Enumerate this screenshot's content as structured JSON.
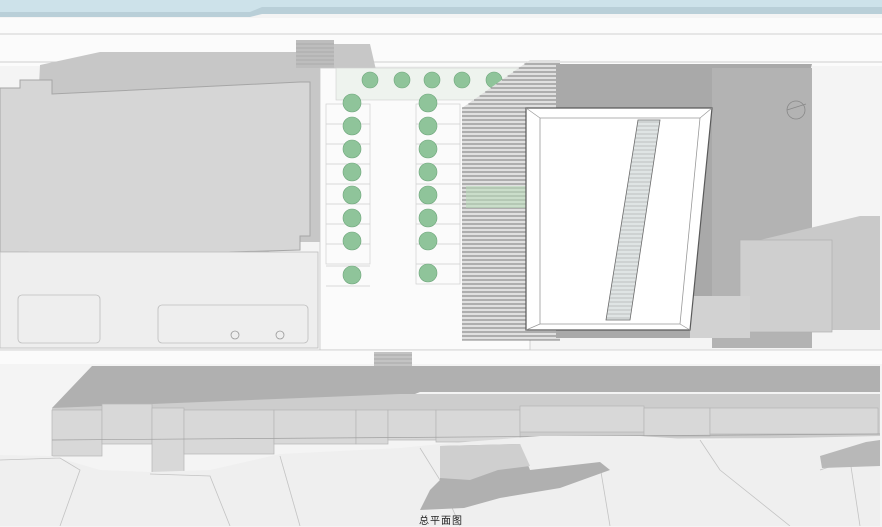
{
  "caption": "总平面图",
  "colors": {
    "ground": "#f4f4f4",
    "water": "#cde2ea",
    "road": "#fafafa",
    "building_dark": "#a9a9a9",
    "building_mid": "#c3c3c3",
    "building_light": "#dadada",
    "tree": "#8fc49a",
    "line": "#9a9a9a"
  },
  "icons": [
    "tree-icon",
    "manhole-icon"
  ]
}
